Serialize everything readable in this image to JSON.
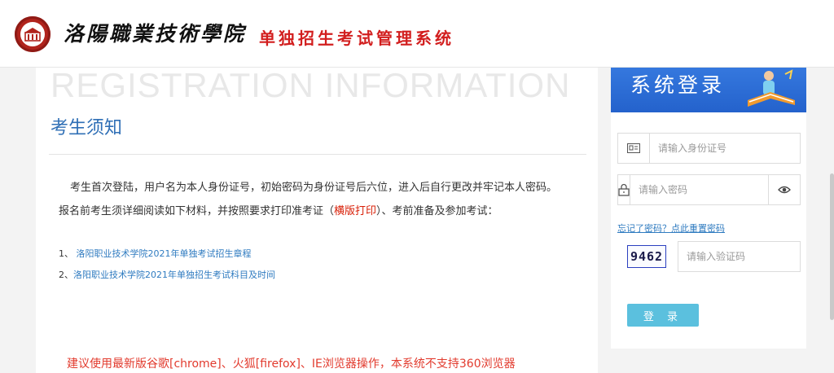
{
  "header": {
    "school_name": "洛陽職業技術學院",
    "system_title": "单独招生考试管理系统"
  },
  "notice": {
    "watermark": "REGISTRATION INFORMATION",
    "title": "考生须知",
    "para1": "考生首次登陆，用户名为本人身份证号，初始密码为身份证号后六位，进入后自行更改并牢记本人密码。",
    "para2_before": "报名前考生须详细阅读如下材料，并按照要求打印准考证（",
    "para2_red": "横版打印",
    "para2_after": "）、考前准备及参加考试：",
    "links": [
      {
        "prefix": "1、 ",
        "text": "洛阳职业技术学院2021年单独考试招生章程"
      },
      {
        "prefix": "2、",
        "text": "洛阳职业技术学院2021年单独招生考试科目及时间"
      }
    ],
    "warning": "建议使用最新版谷歌[chrome]、火狐[firefox]、IE浏览器操作，本系统不支持360浏览器"
  },
  "login": {
    "banner_title": "系统登录",
    "id_placeholder": "请输入身份证号",
    "id_icon": "id-card-icon",
    "password_placeholder": "请输入密码",
    "password_icon": "lock-icon",
    "eye_icon": "eye-icon",
    "forgot_text": "忘记了密码？点此重置密码",
    "captcha_value": "9462",
    "captcha_placeholder": "请输入验证码",
    "login_label": "登 录"
  },
  "colors": {
    "brand_red": "#d21e1e",
    "title_blue": "#2f6fb6",
    "link_blue": "#2f7bc0",
    "button_cyan": "#5bc0de",
    "warning_red": "#e23b2e"
  }
}
